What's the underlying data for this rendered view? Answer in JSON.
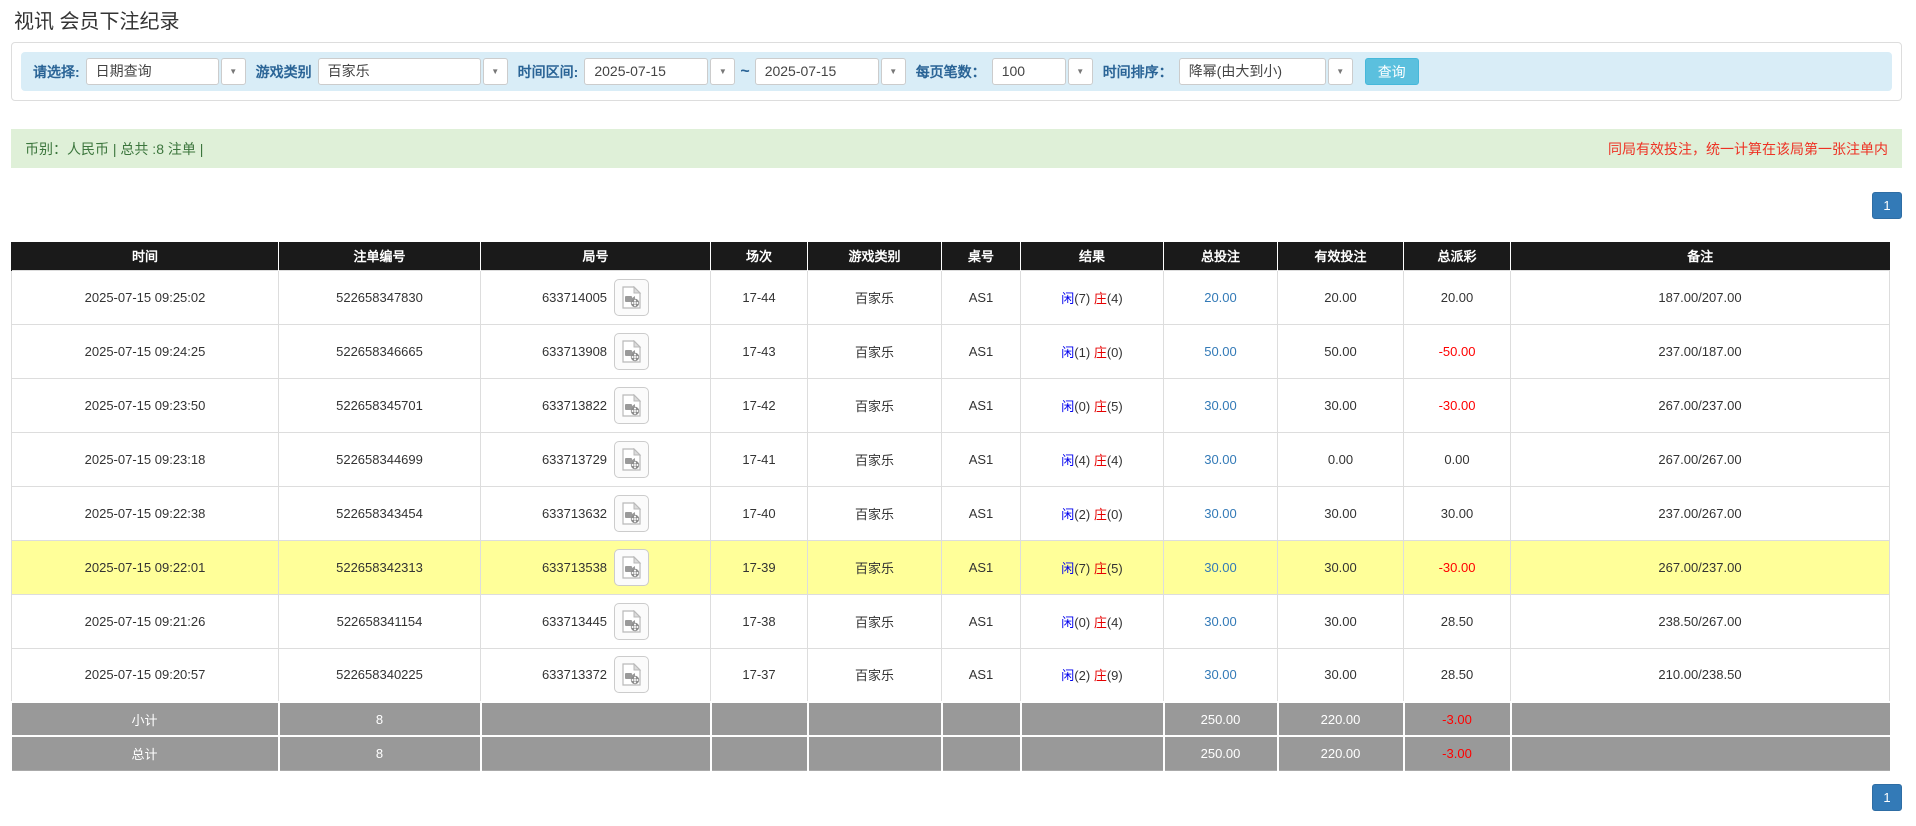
{
  "page": {
    "title": "视讯 会员下注纪录"
  },
  "filters": {
    "select_label": "请选择:",
    "select_value": "日期查询",
    "game_label": "游戏类别",
    "game_value": "百家乐",
    "range_label": "时间区间:",
    "date_from": "2025-07-15",
    "tilde": "~",
    "date_to": "2025-07-15",
    "per_page_label": "每页笔数：",
    "per_page_value": "100",
    "sort_label": "时间排序：",
    "sort_value": "降幂(由大到小)",
    "search_button": "查询",
    "dropdown_arrow_icon": "▼"
  },
  "summary": {
    "left": "币别：人民币 | 总共 :8 注单 |",
    "right": "同局有效投注，统一计算在该局第一张注单内"
  },
  "pagination": {
    "page": "1"
  },
  "table": {
    "headers": [
      "时间",
      "注单编号",
      "局号",
      "场次",
      "游戏类别",
      "桌号",
      "结果",
      "总投注",
      "有效投注",
      "总派彩",
      "备注"
    ],
    "rows": [
      {
        "time": "2025-07-15 09:25:02",
        "bet_id": "522658347830",
        "round_id": "633714005",
        "session": "17-44",
        "game": "百家乐",
        "table": "AS1",
        "result": {
          "player_label": "闲",
          "player_num": "(7)",
          "banker_label": "庄",
          "banker_num": "(4)"
        },
        "total_bet": "20.00",
        "valid_bet": "20.00",
        "payout": "20.00",
        "remark": "187.00/207.00",
        "highlighted": false
      },
      {
        "time": "2025-07-15 09:24:25",
        "bet_id": "522658346665",
        "round_id": "633713908",
        "session": "17-43",
        "game": "百家乐",
        "table": "AS1",
        "result": {
          "player_label": "闲",
          "player_num": "(1)",
          "banker_label": "庄",
          "banker_num": "(0)"
        },
        "total_bet": "50.00",
        "valid_bet": "50.00",
        "payout": "-50.00",
        "remark": "237.00/187.00",
        "highlighted": false
      },
      {
        "time": "2025-07-15 09:23:50",
        "bet_id": "522658345701",
        "round_id": "633713822",
        "session": "17-42",
        "game": "百家乐",
        "table": "AS1",
        "result": {
          "player_label": "闲",
          "player_num": "(0)",
          "banker_label": "庄",
          "banker_num": "(5)"
        },
        "total_bet": "30.00",
        "valid_bet": "30.00",
        "payout": "-30.00",
        "remark": "267.00/237.00",
        "highlighted": false
      },
      {
        "time": "2025-07-15 09:23:18",
        "bet_id": "522658344699",
        "round_id": "633713729",
        "session": "17-41",
        "game": "百家乐",
        "table": "AS1",
        "result": {
          "player_label": "闲",
          "player_num": "(4)",
          "banker_label": "庄",
          "banker_num": "(4)"
        },
        "total_bet": "30.00",
        "valid_bet": "0.00",
        "payout": "0.00",
        "remark": "267.00/267.00",
        "highlighted": false
      },
      {
        "time": "2025-07-15 09:22:38",
        "bet_id": "522658343454",
        "round_id": "633713632",
        "session": "17-40",
        "game": "百家乐",
        "table": "AS1",
        "result": {
          "player_label": "闲",
          "player_num": "(2)",
          "banker_label": "庄",
          "banker_num": "(0)"
        },
        "total_bet": "30.00",
        "valid_bet": "30.00",
        "payout": "30.00",
        "remark": "237.00/267.00",
        "highlighted": false
      },
      {
        "time": "2025-07-15 09:22:01",
        "bet_id": "522658342313",
        "round_id": "633713538",
        "session": "17-39",
        "game": "百家乐",
        "table": "AS1",
        "result": {
          "player_label": "闲",
          "player_num": "(7)",
          "banker_label": "庄",
          "banker_num": "(5)"
        },
        "total_bet": "30.00",
        "valid_bet": "30.00",
        "payout": "-30.00",
        "remark": "267.00/237.00",
        "highlighted": true
      },
      {
        "time": "2025-07-15 09:21:26",
        "bet_id": "522658341154",
        "round_id": "633713445",
        "session": "17-38",
        "game": "百家乐",
        "table": "AS1",
        "result": {
          "player_label": "闲",
          "player_num": "(0)",
          "banker_label": "庄",
          "banker_num": "(4)"
        },
        "total_bet": "30.00",
        "valid_bet": "30.00",
        "payout": "28.50",
        "remark": "238.50/267.00",
        "highlighted": false
      },
      {
        "time": "2025-07-15 09:20:57",
        "bet_id": "522658340225",
        "round_id": "633713372",
        "session": "17-37",
        "game": "百家乐",
        "table": "AS1",
        "result": {
          "player_label": "闲",
          "player_num": "(2)",
          "banker_label": "庄",
          "banker_num": "(9)"
        },
        "total_bet": "30.00",
        "valid_bet": "30.00",
        "payout": "28.50",
        "remark": "210.00/238.50",
        "highlighted": false
      }
    ],
    "footer": [
      {
        "label": "小计",
        "count": "8",
        "total_bet": "250.00",
        "valid_bet": "220.00",
        "payout": "-3.00"
      },
      {
        "label": "总计",
        "count": "8",
        "total_bet": "250.00",
        "valid_bet": "220.00",
        "payout": "-3.00"
      }
    ]
  },
  "icons": {
    "video_icon": "video-file-icon"
  },
  "colors": {
    "filter_well_bg": "#d9edf7",
    "label_blue": "#2a6496",
    "search_btn_bg": "#5bc0de",
    "summary_bg": "#dff0d8",
    "summary_green": "#3c763d",
    "alert_red": "#ee3224",
    "header_black": "#1a1a1a",
    "highlight_yellow": "#ffff99",
    "footer_gray": "#999999",
    "link_blue": "#337ab7",
    "player_blue": "#0000ee",
    "banker_red": "#e60000",
    "negative_red": "#ff0000",
    "pager_blue": "#337ab7"
  }
}
